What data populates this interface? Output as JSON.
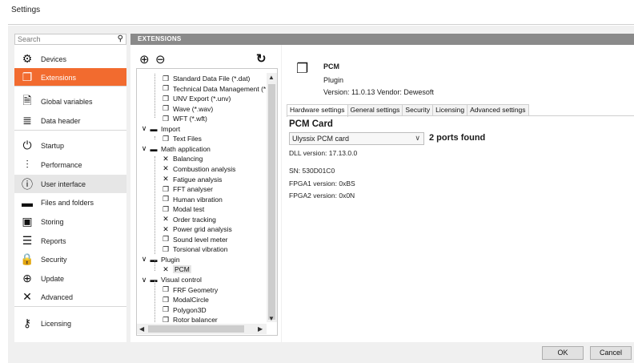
{
  "window": {
    "title": "Settings"
  },
  "search": {
    "placeholder": "Search"
  },
  "nav": {
    "items": [
      {
        "label": "Devices",
        "icon": "gear-icon",
        "glyph": "⚙"
      },
      {
        "label": "Extensions",
        "icon": "extension-cube-icon",
        "glyph": "❐"
      },
      {
        "label": "Global variables",
        "icon": "document-icon",
        "glyph": "🗎"
      },
      {
        "label": "Data header",
        "icon": "database-icon",
        "glyph": "≣"
      },
      {
        "label": "Startup",
        "icon": "power-icon",
        "glyph": "⏻"
      },
      {
        "label": "Performance",
        "icon": "sliders-icon",
        "glyph": "⫶"
      },
      {
        "label": "User interface",
        "icon": "info-icon",
        "glyph": "ⓘ"
      },
      {
        "label": "Files and folders",
        "icon": "folder-icon",
        "glyph": "▬"
      },
      {
        "label": "Storing",
        "icon": "save-icon",
        "glyph": "▣"
      },
      {
        "label": "Reports",
        "icon": "report-icon",
        "glyph": "☰"
      },
      {
        "label": "Security",
        "icon": "lock-icon",
        "glyph": "🔒"
      },
      {
        "label": "Update",
        "icon": "update-arrow-icon",
        "glyph": "⊕"
      },
      {
        "label": "Advanced",
        "icon": "tools-icon",
        "glyph": "✕"
      },
      {
        "label": "Licensing",
        "icon": "key-icon",
        "glyph": "⚷"
      }
    ]
  },
  "header": {
    "title": "EXTENSIONS"
  },
  "tree": {
    "add_glyph": "⊕",
    "remove_glyph": "⊖",
    "refresh_glyph": "↻",
    "collapse_glyph": "∨",
    "folder_glyph": "▬",
    "plugin_glyph": "❐",
    "tool_glyph": "✕",
    "rows": [
      {
        "label": "Standard Data File (*.dat)"
      },
      {
        "label": "Technical Data Management (*"
      },
      {
        "label": "UNV Export (*.unv)"
      },
      {
        "label": "Wave (*.wav)"
      },
      {
        "label": "WFT (*.wft)"
      },
      {
        "label": "Import"
      },
      {
        "label": "Text Files"
      },
      {
        "label": "Math application"
      },
      {
        "label": "Balancing"
      },
      {
        "label": "Combustion analysis"
      },
      {
        "label": "Fatigue analysis"
      },
      {
        "label": "FFT analyser"
      },
      {
        "label": "Human vibration"
      },
      {
        "label": "Modal test"
      },
      {
        "label": "Order tracking"
      },
      {
        "label": "Power grid analysis"
      },
      {
        "label": "Sound level meter"
      },
      {
        "label": "Torsional vibration"
      },
      {
        "label": "Plugin"
      },
      {
        "label": "PCM"
      },
      {
        "label": "Visual control"
      },
      {
        "label": "FRF Geometry"
      },
      {
        "label": "ModalCircle"
      },
      {
        "label": "Polygon3D"
      },
      {
        "label": "Rotor balancer"
      }
    ]
  },
  "plugin": {
    "icon_glyph": "❐",
    "name": "PCM",
    "type": "Plugin",
    "version_line": "Version: 11.0.13   Vendor: Dewesoft"
  },
  "tabs": [
    "Hardware settings",
    "General settings",
    "Security",
    "Licensing",
    "Advanced settings"
  ],
  "hardware": {
    "card_title": "PCM Card",
    "card_select": "Ulyssix PCM card",
    "select_chevron": "∨",
    "ports_found": "2 ports found",
    "dll_version": "DLL version:  17.13.0.0",
    "sn": "SN: 530D01C0",
    "fpga1": "FPGA1 version: 0xBS",
    "fpga2": "FPGA2 version: 0x0N"
  },
  "buttons": {
    "ok": "OK",
    "cancel": "Cancel"
  },
  "colors": {
    "accent": "#f26b2f",
    "header_bar": "#8a8a8a",
    "frame": "#f0f0f0"
  }
}
